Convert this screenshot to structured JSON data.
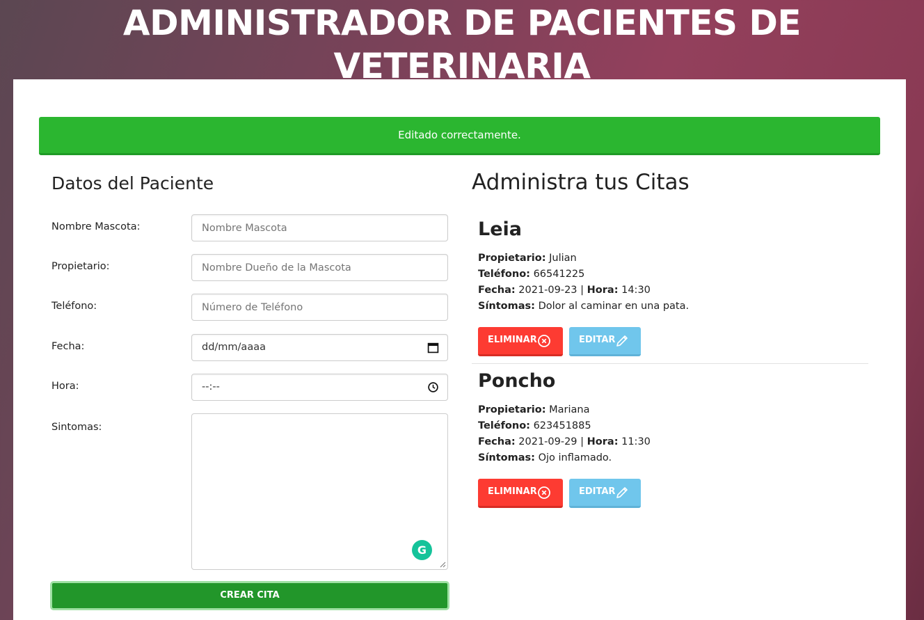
{
  "header": {
    "title": "ADMINISTRADOR DE PACIENTES DE VETERINARIA"
  },
  "alert": {
    "message": "Editado correctamente.",
    "color": "#2bb630"
  },
  "form": {
    "title": "Datos del Paciente",
    "fields": {
      "mascota": {
        "label": "Nombre Mascota:",
        "placeholder": "Nombre Mascota"
      },
      "propietario": {
        "label": "Propietario:",
        "placeholder": "Nombre Dueño de la Mascota"
      },
      "telefono": {
        "label": "Teléfono:",
        "placeholder": "Número de Teléfono"
      },
      "fecha": {
        "label": "Fecha:",
        "value": "dd/mm/aaaa",
        "icon": "calendar-icon"
      },
      "hora": {
        "label": "Hora:",
        "value": "--:--",
        "icon": "clock-icon"
      },
      "sintomas": {
        "label": "Sintomas:",
        "value": ""
      }
    },
    "submit_label": "CREAR CITA"
  },
  "citas": {
    "title": "Administra tus Citas",
    "labels": {
      "propietario": "Propietario:",
      "telefono": "Teléfono:",
      "fecha": "Fecha:",
      "hora": "Hora:",
      "sintomas": "Síntomas:",
      "separator": "|"
    },
    "delete_label": "ELIMINAR",
    "edit_label": "EDITAR",
    "items": [
      {
        "mascota": "Leia",
        "propietario": "Julian",
        "telefono": "66541225",
        "fecha": "2021-09-23",
        "hora": "14:30",
        "sintomas": "Dolor al caminar en una pata."
      },
      {
        "mascota": "Poncho",
        "propietario": "Mariana",
        "telefono": "623451885",
        "fecha": "2021-09-29",
        "hora": "11:30",
        "sintomas": "Ojo inflamado."
      }
    ]
  },
  "extension": {
    "icon": "grammarly-icon",
    "glyph": "G"
  },
  "colors": {
    "delete": "#fd3b32",
    "edit": "#70c6ec",
    "submit": "#22962a"
  }
}
